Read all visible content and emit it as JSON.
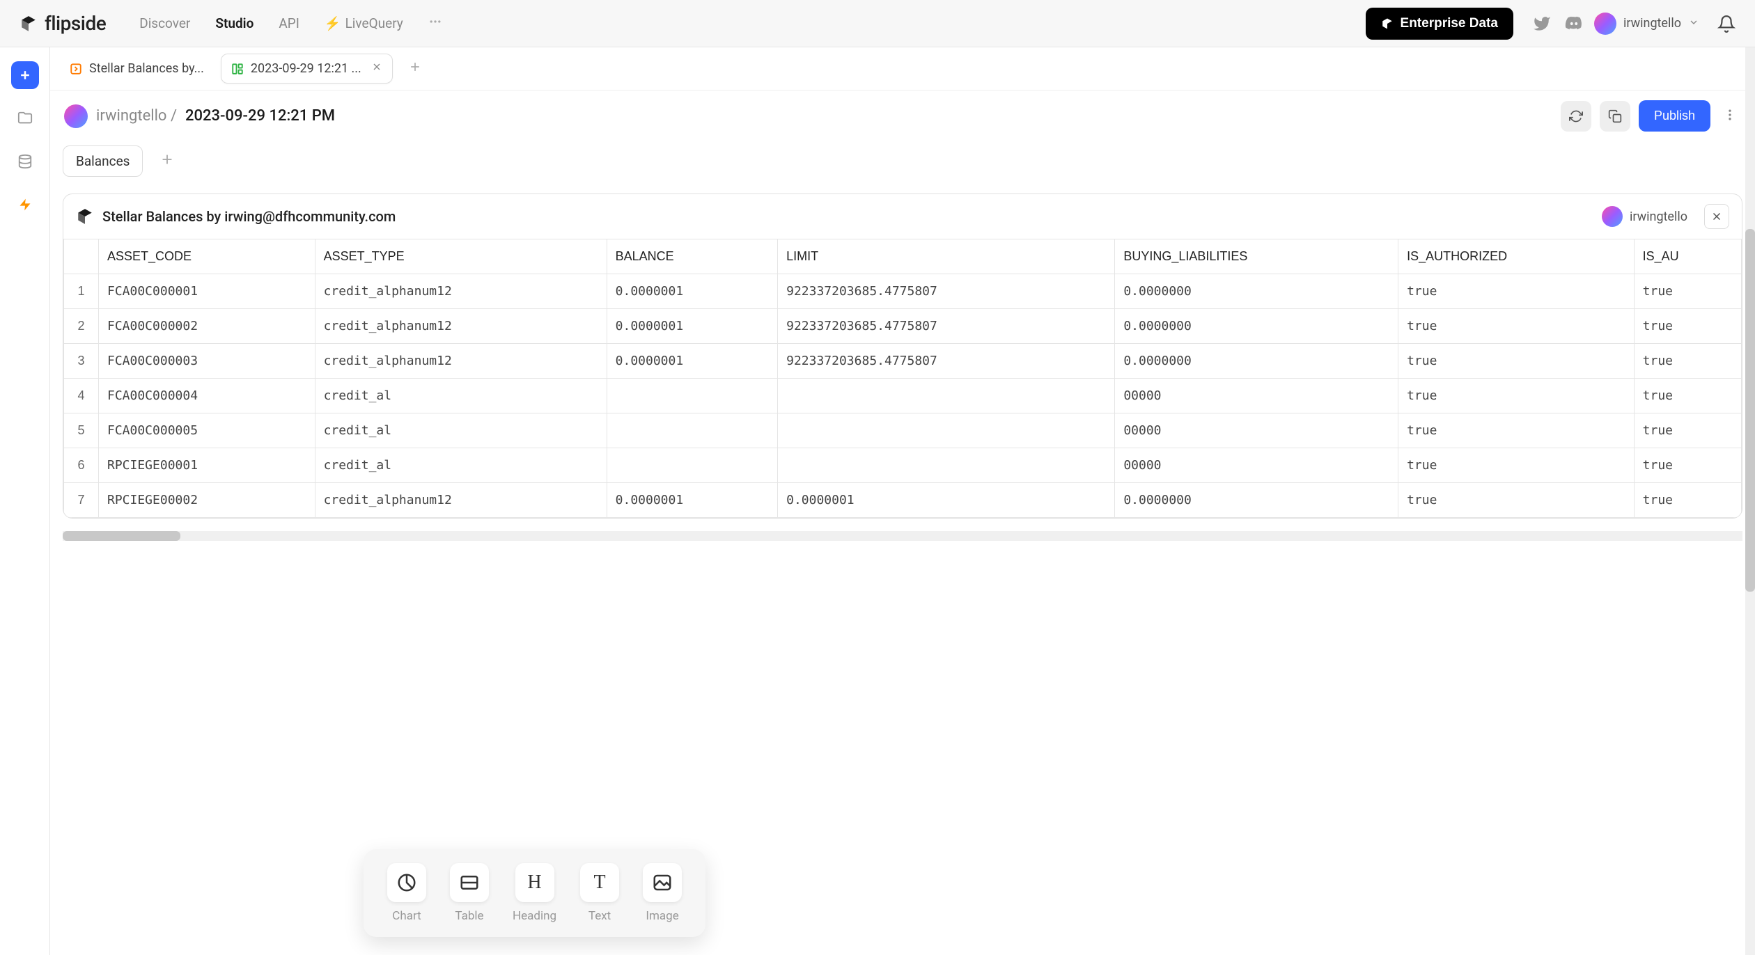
{
  "topbar": {
    "logo_text": "flipside",
    "nav": {
      "discover": "Discover",
      "studio": "Studio",
      "api": "API",
      "livequery": "LiveQuery"
    },
    "enterprise_btn": "Enterprise Data",
    "username": "irwingtello"
  },
  "tabs": [
    {
      "label": "Stellar Balances by...",
      "icon": "orange"
    },
    {
      "label": "2023-09-29 12:21 ...",
      "icon": "green",
      "active": true,
      "closable": true
    }
  ],
  "page_header": {
    "crumb_user": "irwingtello",
    "crumb_sep": " / ",
    "title": "2023-09-29 12:21 PM",
    "publish": "Publish"
  },
  "subtabs": [
    {
      "label": "Balances"
    }
  ],
  "card": {
    "title": "Stellar Balances by irwing@dfhcommunity.com",
    "user": "irwingtello"
  },
  "table": {
    "columns": [
      "ASSET_CODE",
      "ASSET_TYPE",
      "BALANCE",
      "LIMIT",
      "BUYING_LIABILITIES",
      "IS_AUTHORIZED",
      "IS_AU"
    ],
    "rows": [
      [
        "1",
        "FCA00C000001",
        "credit_alphanum12",
        "0.0000001",
        "922337203685.4775807",
        "0.0000000",
        "true",
        "true"
      ],
      [
        "2",
        "FCA00C000002",
        "credit_alphanum12",
        "0.0000001",
        "922337203685.4775807",
        "0.0000000",
        "true",
        "true"
      ],
      [
        "3",
        "FCA00C000003",
        "credit_alphanum12",
        "0.0000001",
        "922337203685.4775807",
        "0.0000000",
        "true",
        "true"
      ],
      [
        "4",
        "FCA00C000004",
        "credit_al",
        "",
        "",
        "00000",
        "true",
        "true"
      ],
      [
        "5",
        "FCA00C000005",
        "credit_al",
        "",
        "",
        "00000",
        "true",
        "true"
      ],
      [
        "6",
        "RPCIEGE00001",
        "credit_al",
        "",
        "",
        "00000",
        "true",
        "true"
      ],
      [
        "7",
        "RPCIEGE00002",
        "credit_alphanum12",
        "0.0000001",
        "0.0000001",
        "0.0000000",
        "true",
        "true"
      ]
    ]
  },
  "float_toolbar": [
    {
      "label": "Chart",
      "icon": "chart"
    },
    {
      "label": "Table",
      "icon": "table"
    },
    {
      "label": "Heading",
      "icon": "heading"
    },
    {
      "label": "Text",
      "icon": "text"
    },
    {
      "label": "Image",
      "icon": "image"
    }
  ]
}
